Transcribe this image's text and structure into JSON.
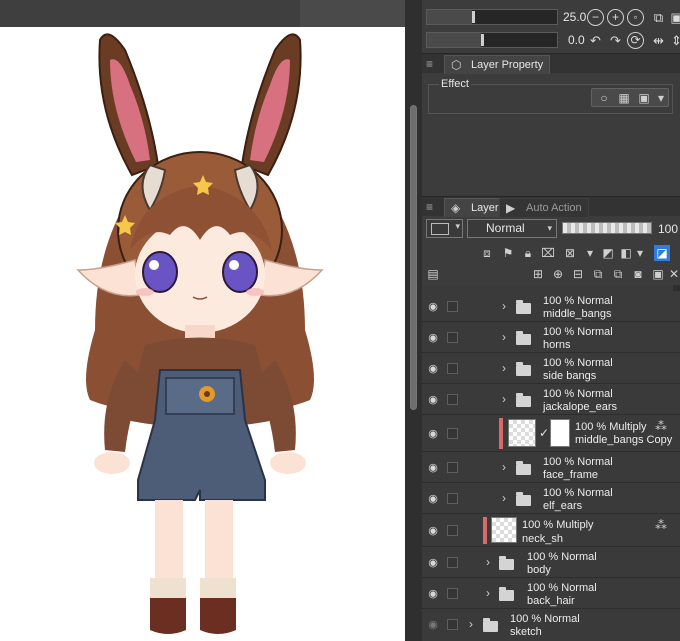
{
  "tool_property": {
    "brush_size_value": "25.0",
    "stabilization_value": "0.0"
  },
  "layer_property": {
    "tab_label": "Layer Property",
    "effect_label": "Effect"
  },
  "layer_palette": {
    "tabs": [
      {
        "label": "Layer"
      },
      {
        "label": "Auto Action"
      }
    ],
    "blend_mode": "Normal",
    "opacity_value": "100",
    "layers": [
      {
        "name": "middle_bangs",
        "mode": "100 % Normal",
        "kind": "folder",
        "level": 2
      },
      {
        "name": "horns",
        "mode": "100 % Normal",
        "kind": "folder",
        "level": 2
      },
      {
        "name": "side bangs",
        "mode": "100 % Normal",
        "kind": "folder",
        "level": 2
      },
      {
        "name": "jackalope_ears",
        "mode": "100 % Normal",
        "kind": "folder",
        "level": 2
      },
      {
        "name": "middle_bangs Copy",
        "mode": "100 % Multiply",
        "kind": "raster-mask",
        "level": 2
      },
      {
        "name": "face_frame",
        "mode": "100 % Normal",
        "kind": "folder",
        "level": 2
      },
      {
        "name": "elf_ears",
        "mode": "100 % Normal",
        "kind": "folder",
        "level": 2
      },
      {
        "name": "neck_sh",
        "mode": "100 % Multiply",
        "kind": "raster",
        "level": 1
      },
      {
        "name": "body",
        "mode": "100 % Normal",
        "kind": "folder",
        "level": 1
      },
      {
        "name": "back_hair",
        "mode": "100 % Normal",
        "kind": "folder",
        "level": 1
      },
      {
        "name": "sketch",
        "mode": "100 % Normal",
        "kind": "folder",
        "level": 0
      }
    ]
  },
  "colors": {
    "panel_bg": "#3c3c3c",
    "clip_indicator": "#d86a6a",
    "canvas_bg": "#ffffff"
  }
}
